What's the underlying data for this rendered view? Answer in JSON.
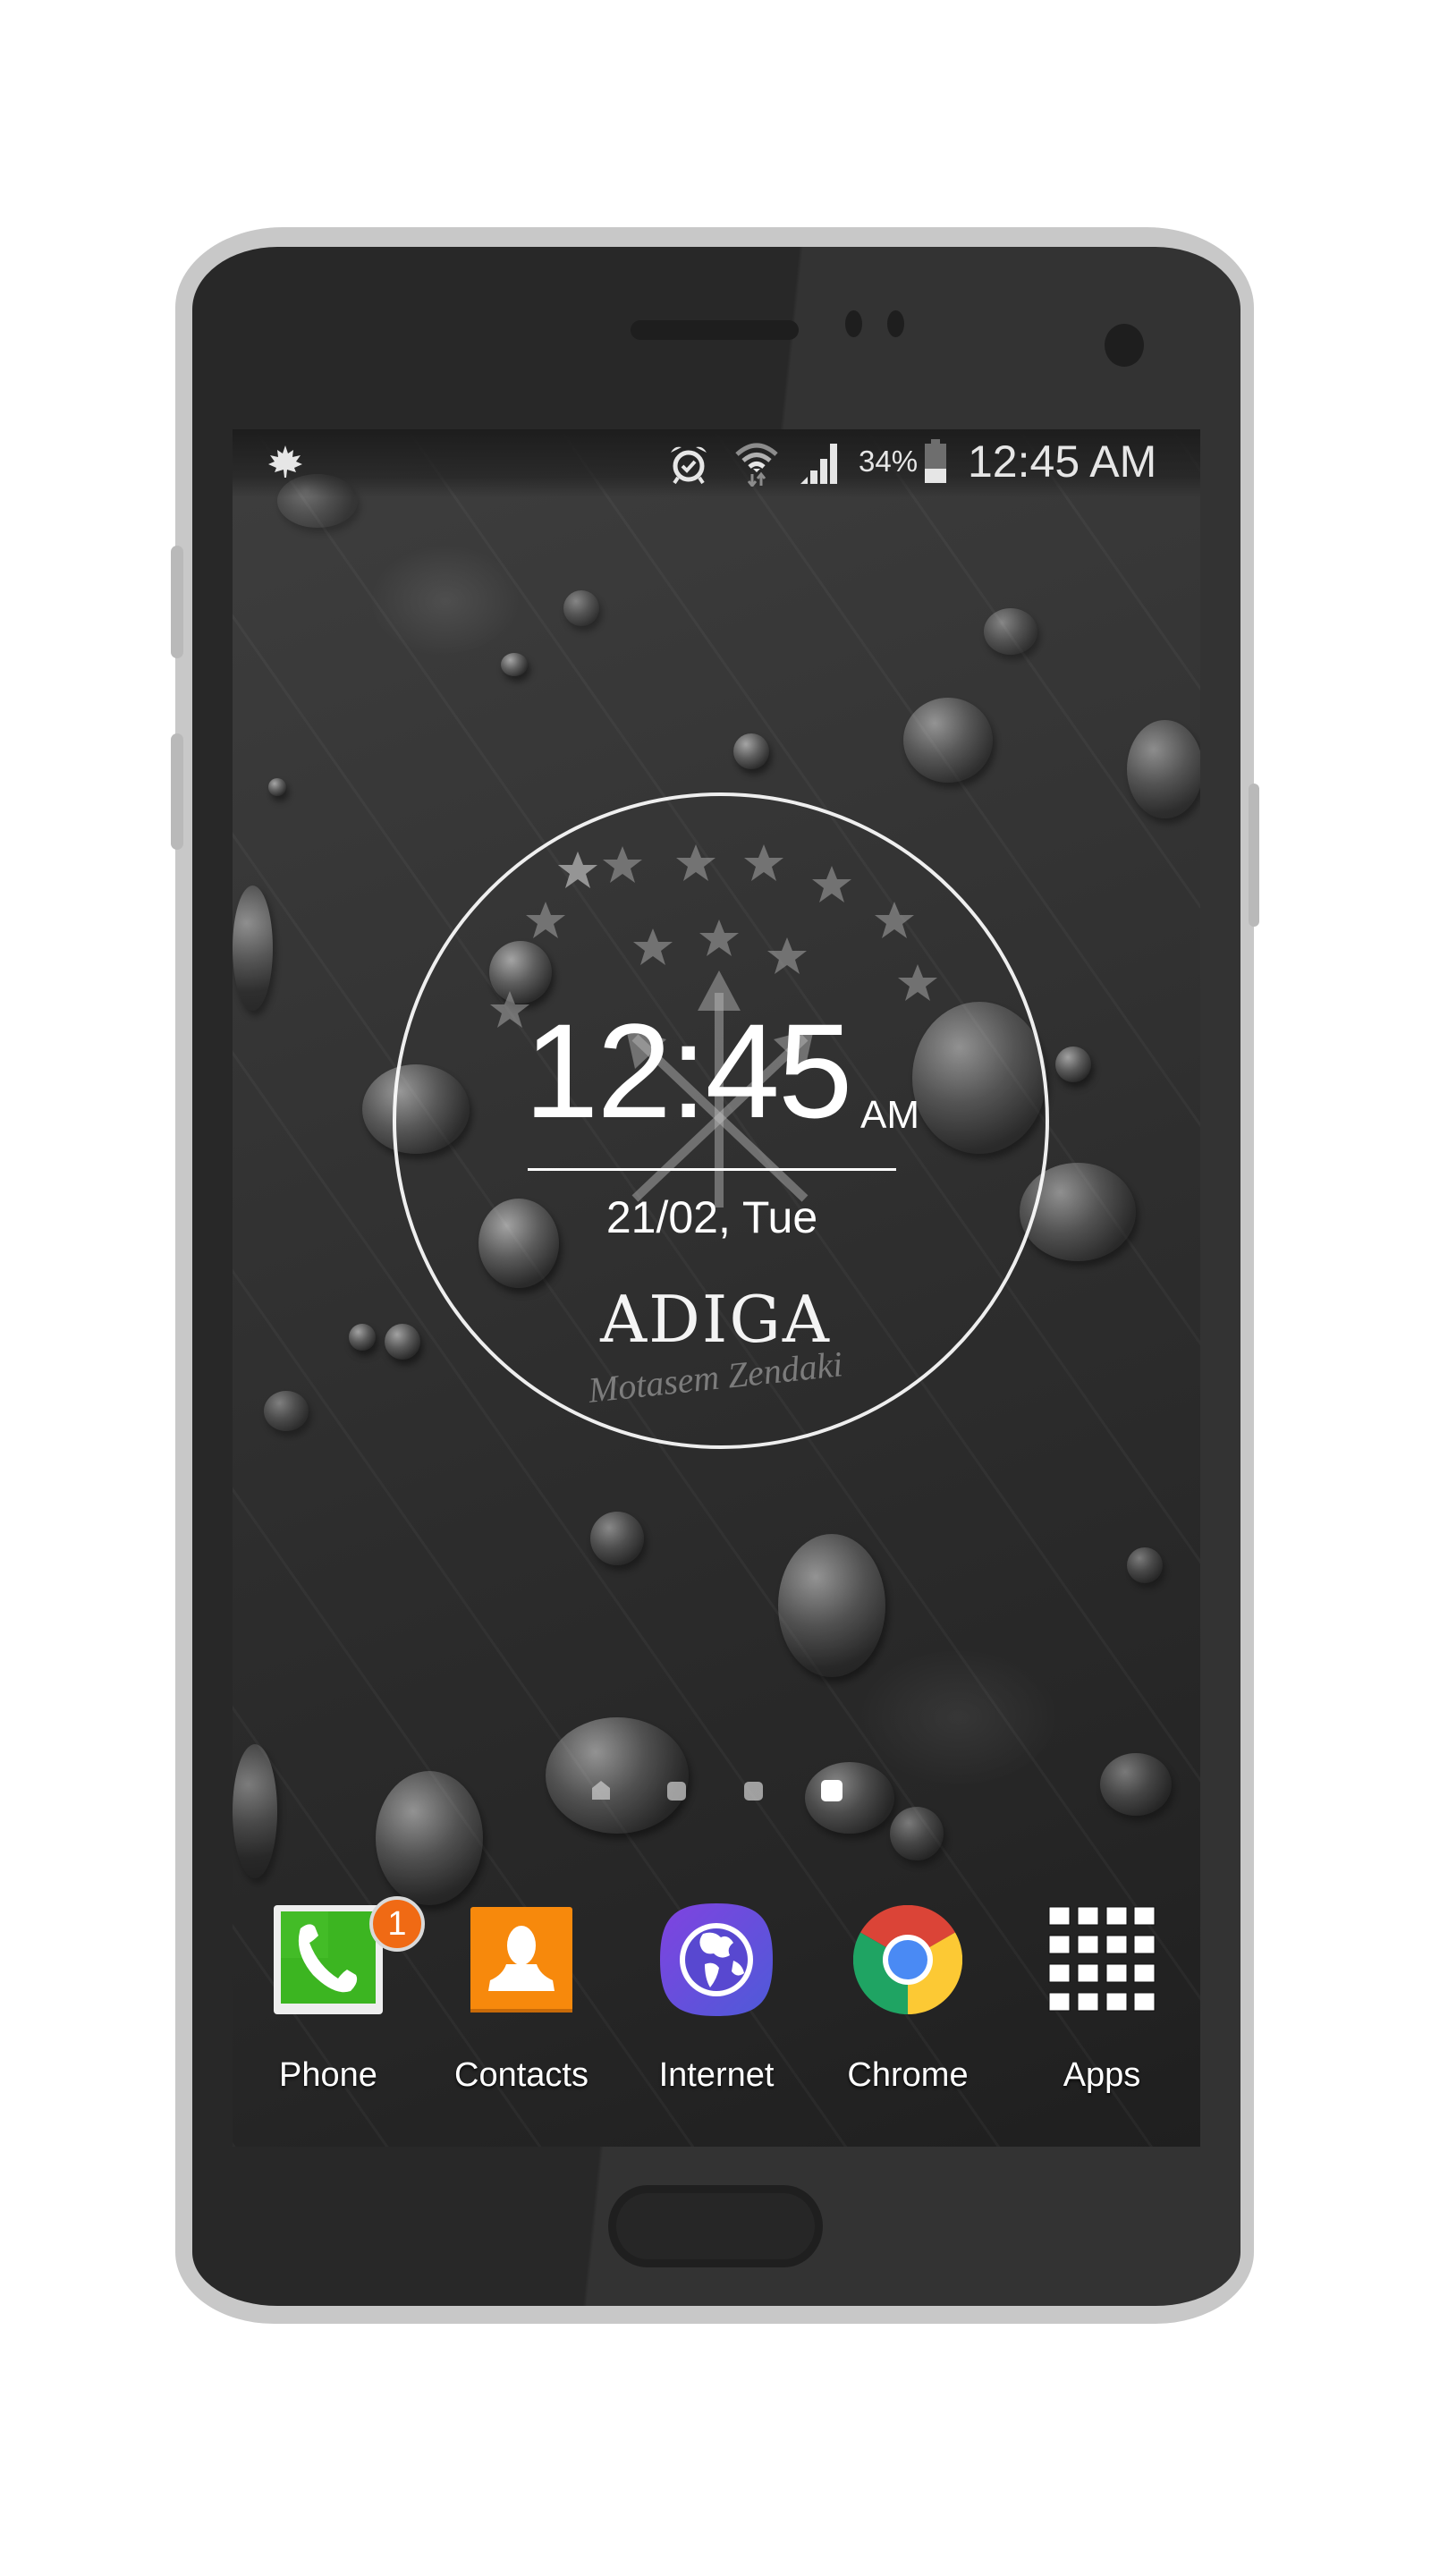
{
  "device": {
    "model_style": "Android phone frame"
  },
  "status_bar": {
    "notification_icon": "maple-leaf-icon",
    "icons": [
      "alarm-clock-icon",
      "wifi-icon",
      "cellular-signal-icon",
      "battery-icon"
    ],
    "battery_percent": "34%",
    "battery_level": 0.34,
    "time": "12:45 AM"
  },
  "clock_widget": {
    "time": "12:45",
    "ampm": "AM",
    "date": "21/02, Tue",
    "title": "ADIGA",
    "signature": "Motasem Zendaki",
    "emblem": "adyghe-flag-stars-arrows"
  },
  "home_pages": {
    "count": 4,
    "current_index": 3,
    "first_is_home": true
  },
  "dock": {
    "apps": [
      {
        "label": "Phone",
        "icon": "phone-icon",
        "badge": "1",
        "color": "#3cb521"
      },
      {
        "label": "Contacts",
        "icon": "contacts-icon",
        "color": "#f7890c"
      },
      {
        "label": "Internet",
        "icon": "globe-icon",
        "color": "#5d4fd6"
      },
      {
        "label": "Chrome",
        "icon": "chrome-icon"
      },
      {
        "label": "Apps",
        "icon": "apps-grid-icon"
      }
    ]
  },
  "colors": {
    "frame": "#c8c8c8",
    "bezel": "#2b2b2b",
    "badge": "#f06a14"
  }
}
